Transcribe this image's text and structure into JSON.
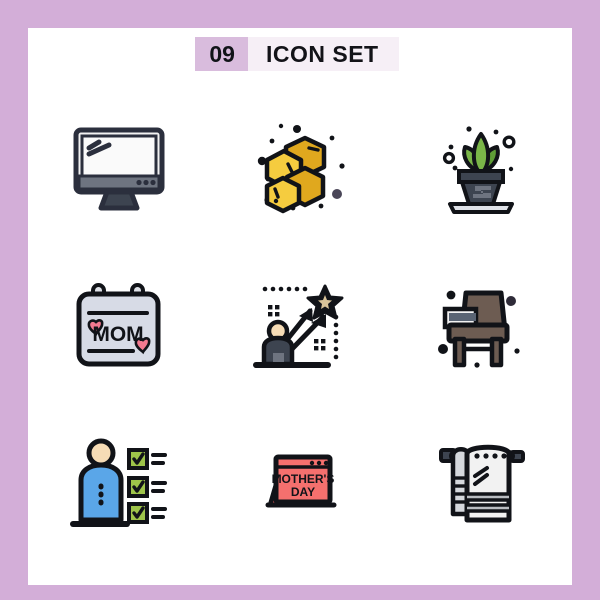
{
  "page": {
    "background_color": "#d3aed8",
    "canvas_color": "#ffffff"
  },
  "header": {
    "number": "09",
    "title": "ICON SET",
    "number_bg": "#d9bcdd",
    "title_bg": "#f6eff6",
    "text_color": "#131318"
  },
  "palette": {
    "outline": "#111318",
    "navy": "#2b2f3d",
    "slate": "#3d4450",
    "screen": "#f2f2f2",
    "gray_bar": "#6e7480",
    "honey_light": "#f5cc3f",
    "honey_dark": "#e0a81e",
    "leaf_green": "#7ab648",
    "leaf_dark": "#5f9e36",
    "calendar_paper": "#d7dbe6",
    "heart_pink": "#f2798f",
    "skin": "#f6dcb6",
    "desk_brown": "#6d5c52",
    "desk_dark": "#5a4a41",
    "desk_slate": "#5a6474",
    "body_blue": "#5aa6e8",
    "check_green": "#9ec44a",
    "check_green_dark": "#7fa63a",
    "card_coral": "#f5706e",
    "card_coral_dark": "#e05b5c",
    "towel_white": "#f2f2f2",
    "towel_gray": "#b9bcc1",
    "star_tan": "#d9c49a"
  },
  "icons": [
    {
      "id": "monitor",
      "name": "computer-monitor-icon",
      "label": "Computer Monitor",
      "row": 1,
      "col": 1
    },
    {
      "id": "honeycomb",
      "name": "honeycomb-icon",
      "label": "Honeycomb",
      "row": 1,
      "col": 2
    },
    {
      "id": "plant",
      "name": "potted-plant-icon",
      "label": "Potted Plant",
      "row": 1,
      "col": 3
    },
    {
      "id": "mom-calendar",
      "name": "mom-calendar-icon",
      "label": "Mom Calendar",
      "row": 2,
      "col": 1,
      "text": "MOM"
    },
    {
      "id": "ambition",
      "name": "ambition-goal-icon",
      "label": "Ambition Goal",
      "row": 2,
      "col": 2
    },
    {
      "id": "desk",
      "name": "school-desk-icon",
      "label": "School Desk",
      "row": 2,
      "col": 3
    },
    {
      "id": "checklist",
      "name": "person-checklist-icon",
      "label": "Person Checklist",
      "row": 3,
      "col": 1
    },
    {
      "id": "mothers-card",
      "name": "mothers-day-card-icon",
      "label": "Mother's Day Card",
      "row": 3,
      "col": 2,
      "line1": "MOTHER'S",
      "line2": "DAY"
    },
    {
      "id": "towel",
      "name": "towel-rail-icon",
      "label": "Towel on Rail",
      "row": 3,
      "col": 3
    }
  ]
}
